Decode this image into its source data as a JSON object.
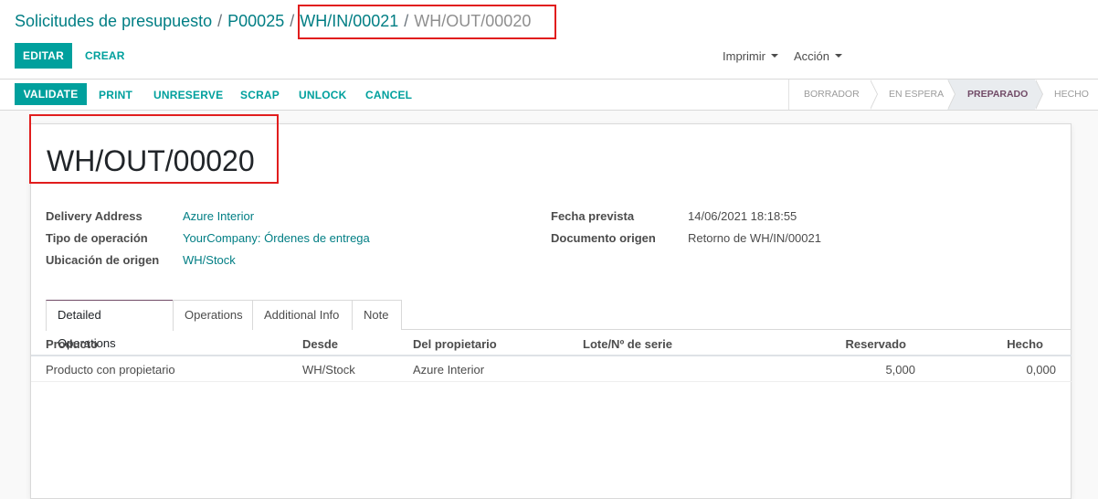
{
  "breadcrumb": {
    "items": [
      "Solicitudes de presupuesto",
      "P00025",
      "WH/IN/00021"
    ],
    "separator": "/",
    "current": "WH/OUT/00020"
  },
  "buttons": {
    "edit": "EDITAR",
    "create": "CREAR",
    "print_menu": "Imprimir",
    "action_menu": "Acción"
  },
  "statusbar": {
    "actions": [
      "VALIDATE",
      "PRINT",
      "UNRESERVE",
      "SCRAP",
      "UNLOCK",
      "CANCEL"
    ],
    "stages": [
      "BORRADOR",
      "EN ESPERA",
      "PREPARADO",
      "HECHO"
    ],
    "active_stage": "PREPARADO"
  },
  "record": {
    "title": "WH/OUT/00020",
    "left_fields": [
      {
        "label": "Delivery Address",
        "value": "Azure Interior"
      },
      {
        "label": "Tipo de operación",
        "value": "YourCompany: Órdenes de entrega"
      },
      {
        "label": "Ubicación de origen",
        "value": "WH/Stock"
      }
    ],
    "right_fields": [
      {
        "label": "Fecha prevista",
        "value": "14/06/2021 18:18:55"
      },
      {
        "label": "Documento origen",
        "value": "Retorno de WH/IN/00021"
      }
    ]
  },
  "tabs": [
    "Detailed Operations",
    "Operations",
    "Additional Info",
    "Note"
  ],
  "table": {
    "columns": [
      "Producto",
      "Desde",
      "Del propietario",
      "Lote/Nº de serie",
      "Reservado",
      "Hecho"
    ],
    "rows": [
      [
        "Producto con propietario",
        "WH/Stock",
        "Azure Interior",
        "",
        "5,000",
        "0,000"
      ]
    ]
  },
  "colors": {
    "primary": "#00a09d",
    "link": "#017e84",
    "highlight": "#e11d1d",
    "active_stage": "#714b67"
  }
}
